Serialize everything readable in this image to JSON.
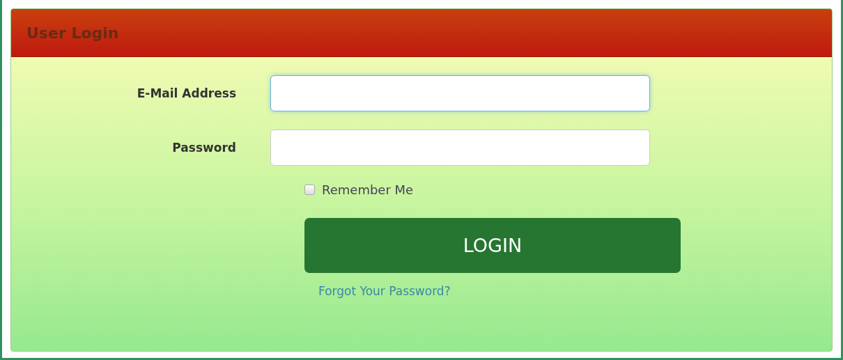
{
  "panel": {
    "title": "User Login"
  },
  "fields": [
    {
      "label": "E-Mail Address",
      "focused": true
    },
    {
      "label": "Password",
      "focused": false
    }
  ],
  "remember": {
    "label": "Remember Me",
    "checked": false
  },
  "login_button": {
    "label": "LOGIN"
  },
  "forgot_link": {
    "label": "Forgot Your Password?"
  }
}
